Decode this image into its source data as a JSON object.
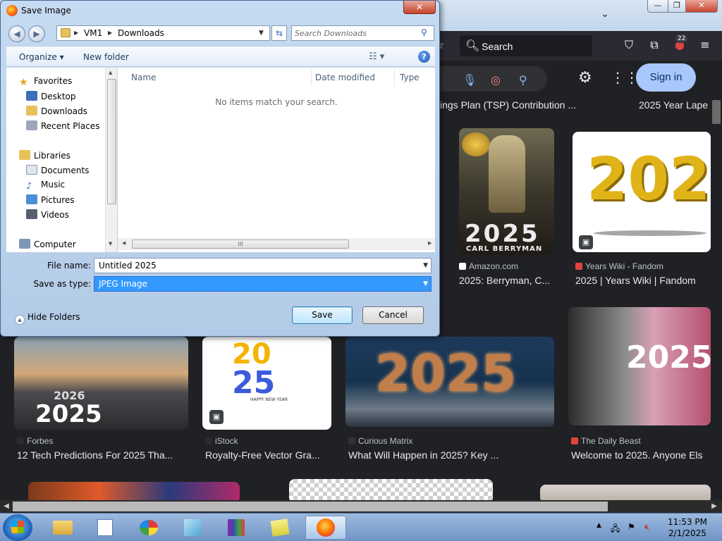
{
  "dialog": {
    "title": "Save Image",
    "close_label": "✕",
    "back_label": "◀",
    "forward_label": "▶",
    "address": {
      "crumbs": [
        "VM1",
        "Downloads"
      ],
      "separator": "▶",
      "dropdown": "▼"
    },
    "refresh_label": "⇆",
    "search_placeholder": "Search Downloads",
    "search_icon": "magnifier-icon",
    "toolbar": {
      "organize": "Organize ▾",
      "new_folder": "New folder",
      "view_label": "☷ ▾",
      "help_label": "?"
    },
    "nav": {
      "favorites": "Favorites",
      "desktop": "Desktop",
      "downloads": "Downloads",
      "recent_places": "Recent Places",
      "libraries": "Libraries",
      "documents": "Documents",
      "music": "Music",
      "pictures": "Pictures",
      "videos": "Videos",
      "computer": "Computer"
    },
    "columns": {
      "name": "Name",
      "date_modified": "Date modified",
      "type": "Type"
    },
    "empty_message": "No items match your search.",
    "file_name_label": "File name:",
    "file_name_value": "Untitled 2025",
    "save_type_label": "Save as type:",
    "save_type_value": "JPEG Image",
    "hide_folders": "Hide Folders",
    "save_button": "Save",
    "cancel_button": "Cancel",
    "scroll_grip": "III"
  },
  "browser": {
    "search_label": "Search",
    "notification_count": "22",
    "sign_in": "Sign in",
    "results": [
      {
        "title": "ings Plan (TSP) Contribution ...",
        "source": ""
      },
      {
        "title": "2025 Year Lape",
        "source": ""
      },
      {
        "title": "2025: Berryman, C...",
        "source": "Amazon.com"
      },
      {
        "title": "2025 | Years Wiki | Fandom",
        "source": "Years Wiki - Fandom"
      },
      {
        "title": "12 Tech Predictions For 2025 Tha...",
        "source": "Forbes"
      },
      {
        "title": "Royalty-Free Vector Gra...",
        "source": "iStock"
      },
      {
        "title": "What Will Happen in 2025? Key ...",
        "source": "Curious Matrix"
      },
      {
        "title": "Welcome to 2025. Anyone Els",
        "source": "The Daily Beast"
      }
    ],
    "book_year": "2025",
    "book_author": "CARL BERRYMAN",
    "big_year": "2025",
    "road_year_small": "2026",
    "road_year_large": "2025",
    "vector_top": "20",
    "vector_bottom": "25",
    "vector_sub": "HAPPY NEW YEAR"
  },
  "taskbar": {
    "time": "11:53 PM",
    "date": "2/1/2025",
    "apps": [
      "folder-icon",
      "document-icon",
      "paint-icon",
      "notebook-icon",
      "winrar-icon",
      "sticky-notes-icon",
      "firefox-icon"
    ]
  },
  "colors": {
    "dialog_frame": "#b3cbe7",
    "selection_blue": "#3399ff",
    "browser_bg": "#202124",
    "sign_in_bg": "#a8c7fa"
  }
}
